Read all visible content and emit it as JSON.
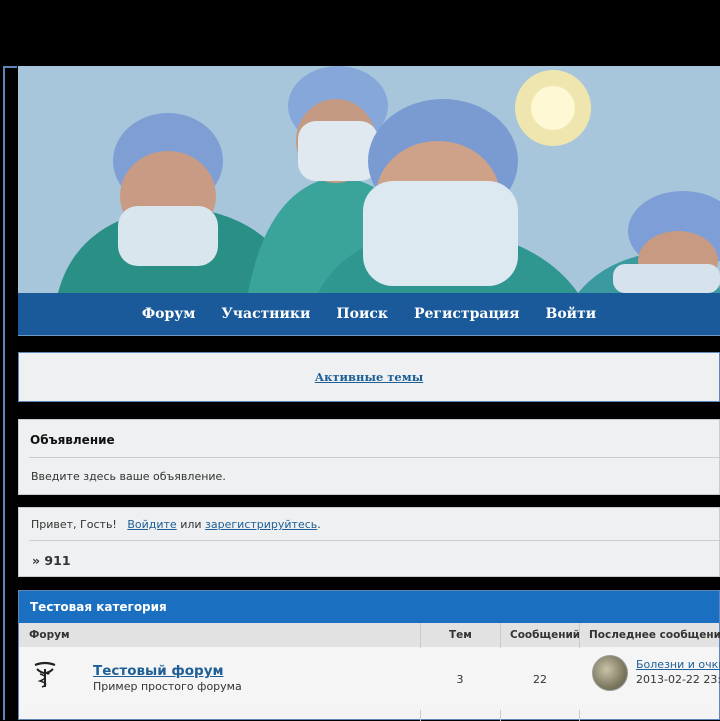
{
  "nav": {
    "items": [
      "Форум",
      "Участники",
      "Поиск",
      "Регистрация",
      "Войти"
    ]
  },
  "active_topics": {
    "label": "Активные темы"
  },
  "announcement": {
    "title": "Объявление",
    "text": "Введите здесь ваше объявление."
  },
  "welcome": {
    "greeting": "Привет, Гость!",
    "login_link": "Войдите",
    "or": "или",
    "register_link": "зарегистрируйтесь",
    "period": "."
  },
  "breadcrumb": "» 911",
  "category": {
    "title": "Тестовая категория",
    "columns": {
      "forum": "Форум",
      "topics": "Тем",
      "posts": "Сообщений",
      "last_post": "Последнее сообщение"
    },
    "forums": [
      {
        "title": "Тестовый форум",
        "description": "Пример простого форума",
        "topics": "3",
        "posts": "22",
        "last_post_title": "Болезни и очки",
        "last_post_date": "2013-02-22 23:"
      }
    ]
  },
  "colors": {
    "nav_bg": "#1a5a9a",
    "category_header": "#1a6fc0",
    "link": "#1d5f96"
  },
  "icons": {
    "forum_icon": "medical-caduceus-icon"
  }
}
